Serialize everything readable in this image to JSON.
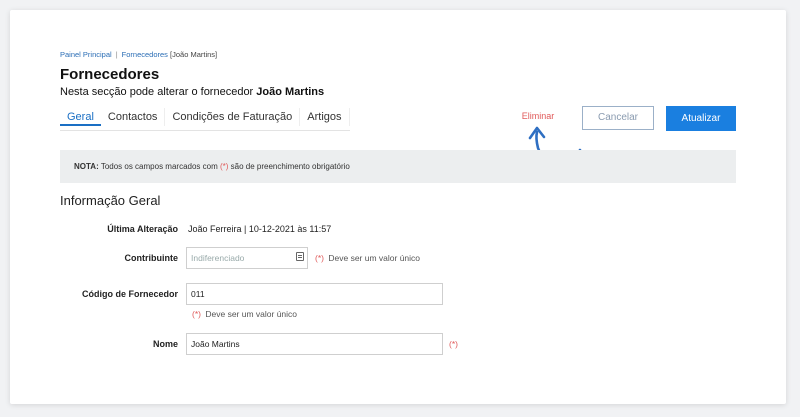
{
  "breadcrumb": {
    "home": "Painel Principal",
    "separator": "|",
    "current": "Fornecedores",
    "tail": "[João Martins]"
  },
  "header": {
    "title": "Fornecedores",
    "subtitle_prefix": "Nesta secção pode alterar o fornecedor",
    "subtitle_name": "João Martins"
  },
  "tabs": [
    {
      "label": "Geral",
      "active": true
    },
    {
      "label": "Contactos",
      "active": false
    },
    {
      "label": "Condições de Faturação",
      "active": false
    },
    {
      "label": "Artigos",
      "active": false
    }
  ],
  "actions": {
    "delete_label": "Eliminar",
    "cancel_label": "Cancelar",
    "update_label": "Atualizar"
  },
  "note": {
    "prefix": "NOTA:",
    "text_before": "Todos os campos marcados com",
    "marker": "(*)",
    "text_after": "são de preenchimento obrigatório"
  },
  "section": {
    "title": "Informação Geral"
  },
  "form": {
    "last_change_label": "Última Alteração",
    "last_change_value": "João Ferreira | 10-12-2021 às 11:57",
    "contribuinte_label": "Contribuinte",
    "contribuinte_placeholder": "Indiferenciado",
    "contribuinte_hint_marker": "(*)",
    "contribuinte_hint": "Deve ser um valor único",
    "codigo_label": "Código de Fornecedor",
    "codigo_value": "011",
    "codigo_hint_marker": "(*)",
    "codigo_hint": "Deve ser um valor único",
    "nome_label": "Nome",
    "nome_value": "João Martins",
    "nome_marker": "(*)"
  },
  "colors": {
    "accent": "#1a7fe0",
    "danger": "#e05a5a",
    "note_bg": "#eceeef"
  },
  "icons": {
    "contribuinte_field": "id-card-icon",
    "annotation": "curved-arrow-icon"
  }
}
